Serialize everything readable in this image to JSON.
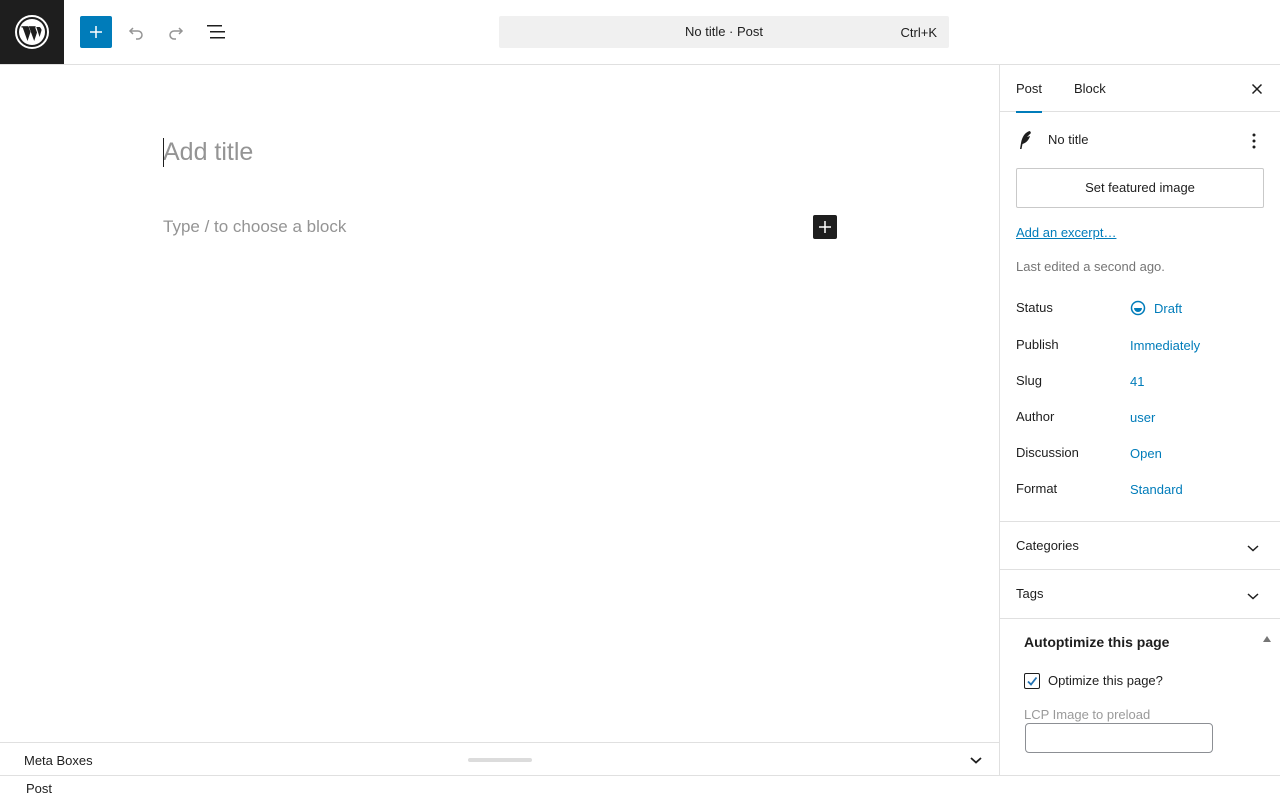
{
  "header": {
    "command_title": "No title · Post",
    "command_shortcut": "Ctrl+K"
  },
  "editor": {
    "title_placeholder": "Add title",
    "block_placeholder": "Type / to choose a block"
  },
  "sidebar": {
    "tabs": [
      {
        "label": "Post",
        "active": true
      },
      {
        "label": "Block",
        "active": false
      }
    ],
    "post_title": "No title",
    "featured_image_button": "Set featured image",
    "excerpt_link": "Add an excerpt…",
    "last_edited": "Last edited a second ago.",
    "meta": [
      {
        "label": "Status",
        "value": "Draft"
      },
      {
        "label": "Publish",
        "value": "Immediately"
      },
      {
        "label": "Slug",
        "value": "41"
      },
      {
        "label": "Author",
        "value": "user"
      },
      {
        "label": "Discussion",
        "value": "Open"
      },
      {
        "label": "Format",
        "value": "Standard"
      }
    ],
    "panels": [
      {
        "label": "Categories"
      },
      {
        "label": "Tags"
      }
    ],
    "autoptimize": {
      "title": "Autoptimize this page",
      "checkbox_label": "Optimize this page?",
      "checkbox_checked": true,
      "lcp_label": "LCP Image to preload",
      "lcp_value": ""
    }
  },
  "metabox_bar": {
    "label": "Meta Boxes"
  },
  "footer": {
    "breadcrumb": "Post"
  },
  "colors": {
    "accent": "#007cba",
    "dark": "#1e1e1e",
    "placeholder": "#949494"
  }
}
